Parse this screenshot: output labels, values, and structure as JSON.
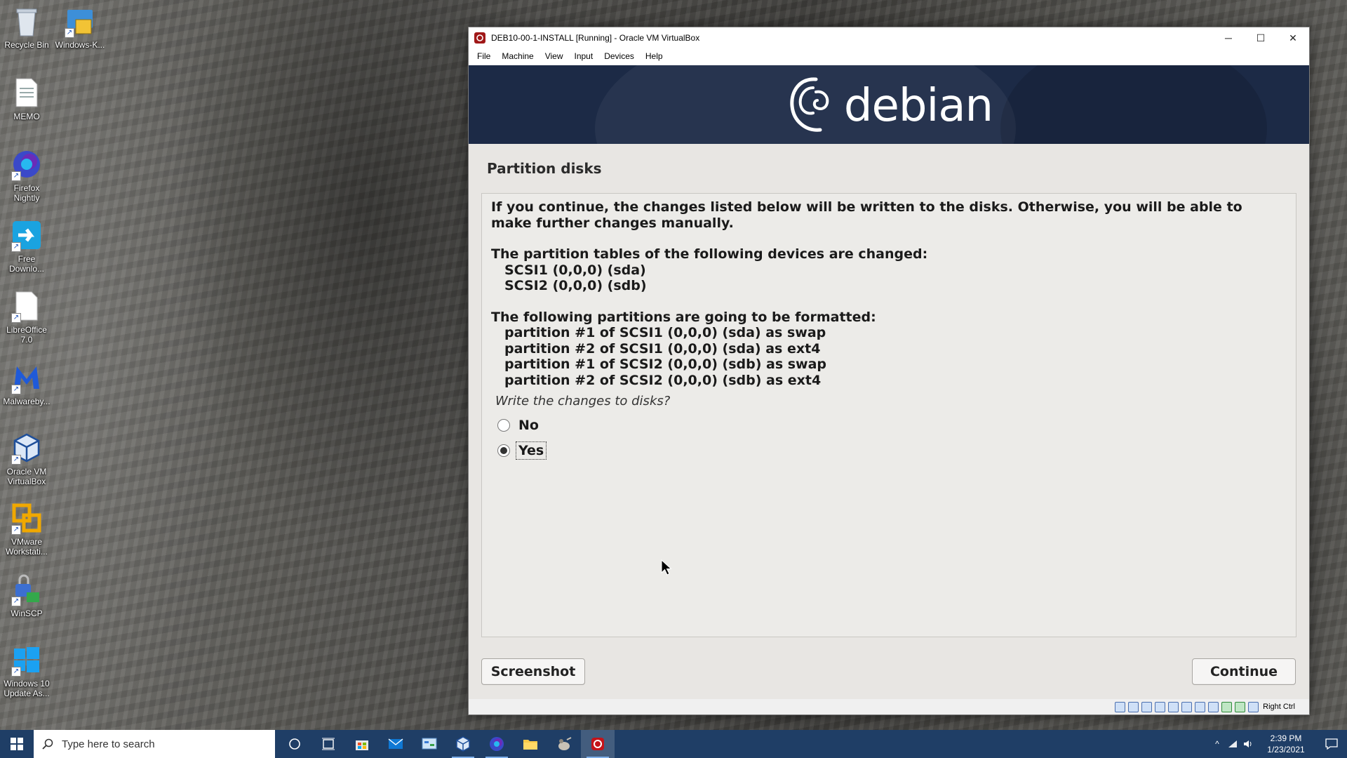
{
  "desktop": {
    "icons": [
      {
        "name": "recycle-bin",
        "label": "Recycle Bin"
      },
      {
        "name": "windows-k",
        "label": "Windows-K..."
      },
      {
        "name": "memo",
        "label": "MEMO"
      },
      {
        "name": "firefox-nightly",
        "label": "Firefox Nightly"
      },
      {
        "name": "free-download",
        "label": "Free Downlo..."
      },
      {
        "name": "libreoffice",
        "label": "LibreOffice 7.0"
      },
      {
        "name": "malwarebytes",
        "label": "Malwareby..."
      },
      {
        "name": "virtualbox",
        "label": "Oracle VM VirtualBox"
      },
      {
        "name": "vmware",
        "label": "VMware Workstati..."
      },
      {
        "name": "winscp",
        "label": "WinSCP"
      },
      {
        "name": "win10-update",
        "label": "Windows 10 Update As..."
      }
    ]
  },
  "window": {
    "title": "DEB10-00-1-INSTALL [Running] - Oracle VM VirtualBox",
    "menu": [
      "File",
      "Machine",
      "View",
      "Input",
      "Devices",
      "Help"
    ],
    "controls": {
      "minimize": "─",
      "maximize": "☐",
      "close": "✕"
    }
  },
  "installer": {
    "logo_text": "debian",
    "step_title": "Partition disks",
    "intro": "If you continue, the changes listed below will be written to the disks. Otherwise, you will be able to make further changes manually.",
    "tables_heading": "The partition tables of the following devices are changed:",
    "devices": [
      "SCSI1 (0,0,0) (sda)",
      "SCSI2 (0,0,0) (sdb)"
    ],
    "format_heading": "The following partitions are going to be formatted:",
    "partitions": [
      "partition #1 of SCSI1 (0,0,0) (sda) as swap",
      "partition #2 of SCSI1 (0,0,0) (sda) as ext4",
      "partition #1 of SCSI2 (0,0,0) (sdb) as swap",
      "partition #2 of SCSI2 (0,0,0) (sdb) as ext4"
    ],
    "question": "Write the changes to disks?",
    "options": [
      {
        "label": "No",
        "selected": false
      },
      {
        "label": "Yes",
        "selected": true
      }
    ],
    "screenshot_button": "Screenshot",
    "continue_button": "Continue"
  },
  "statusbar": {
    "host_key": "Right Ctrl"
  },
  "taskbar": {
    "search_placeholder": "Type here to search",
    "time": "2:39 PM",
    "date": "1/23/2021"
  },
  "colors": {
    "taskbar": "#1f3e66",
    "debian_banner": "#1c2a46",
    "installer_bg": "#e8e6e3"
  }
}
